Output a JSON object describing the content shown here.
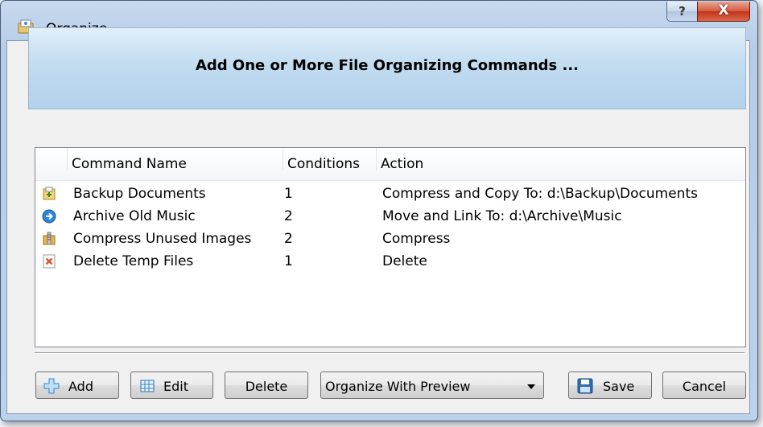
{
  "window": {
    "title": "Organize",
    "help_label": "?",
    "close_label": "X"
  },
  "banner": {
    "text": "Add One or More File Organizing Commands ..."
  },
  "list": {
    "columns": [
      "Command Name",
      "Conditions",
      "Action"
    ],
    "rows": [
      {
        "icon": "backup-copy-icon",
        "name": "Backup Documents",
        "conditions": "1",
        "action": "Compress and Copy To: d:\\Backup\\Documents"
      },
      {
        "icon": "move-arrow-icon",
        "name": "Archive Old Music",
        "conditions": "2",
        "action": "Move and Link To: d:\\Archive\\Music"
      },
      {
        "icon": "compress-icon",
        "name": "Compress Unused Images",
        "conditions": "2",
        "action": "Compress"
      },
      {
        "icon": "delete-icon",
        "name": "Delete Temp Files",
        "conditions": "1",
        "action": "Delete"
      }
    ]
  },
  "buttons": {
    "add": "Add",
    "edit": "Edit",
    "delete": "Delete",
    "organize_mode": "Organize With Preview",
    "save": "Save",
    "cancel": "Cancel"
  },
  "colors": {
    "accent": "#2f86d6",
    "banner_top": "#e2effa",
    "banner_bottom": "#b2d1eb",
    "close": "#c2351a"
  }
}
